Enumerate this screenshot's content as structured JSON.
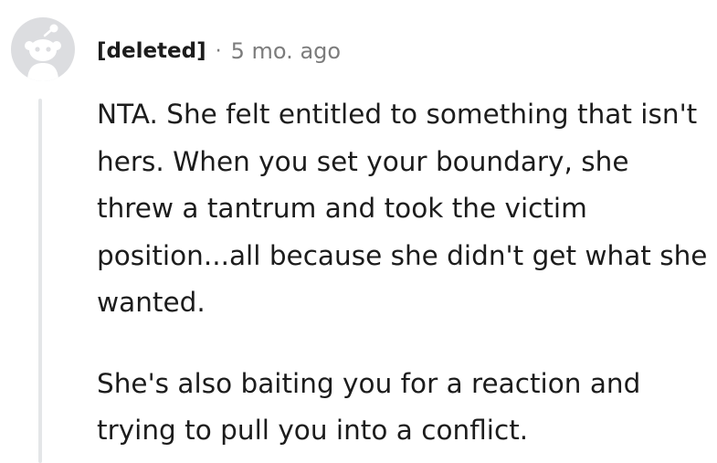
{
  "comment": {
    "author": "[deleted]",
    "separator": "·",
    "timestamp": "5 mo. ago",
    "avatar_icon": "snoo-placeholder-icon",
    "paragraphs": [
      "NTA. She felt entitled to something that isn't hers. When you set your boundary, she threw a tantrum and took the victim position...all because she didn't get what she wanted.",
      "She's also baiting you for a reaction and trying to pull you into a conflict."
    ]
  },
  "colors": {
    "text": "#1c1c1c",
    "meta_text": "#7c7c7c",
    "avatar_bg": "#dcdde0",
    "thread_line": "#e4e6e8"
  }
}
